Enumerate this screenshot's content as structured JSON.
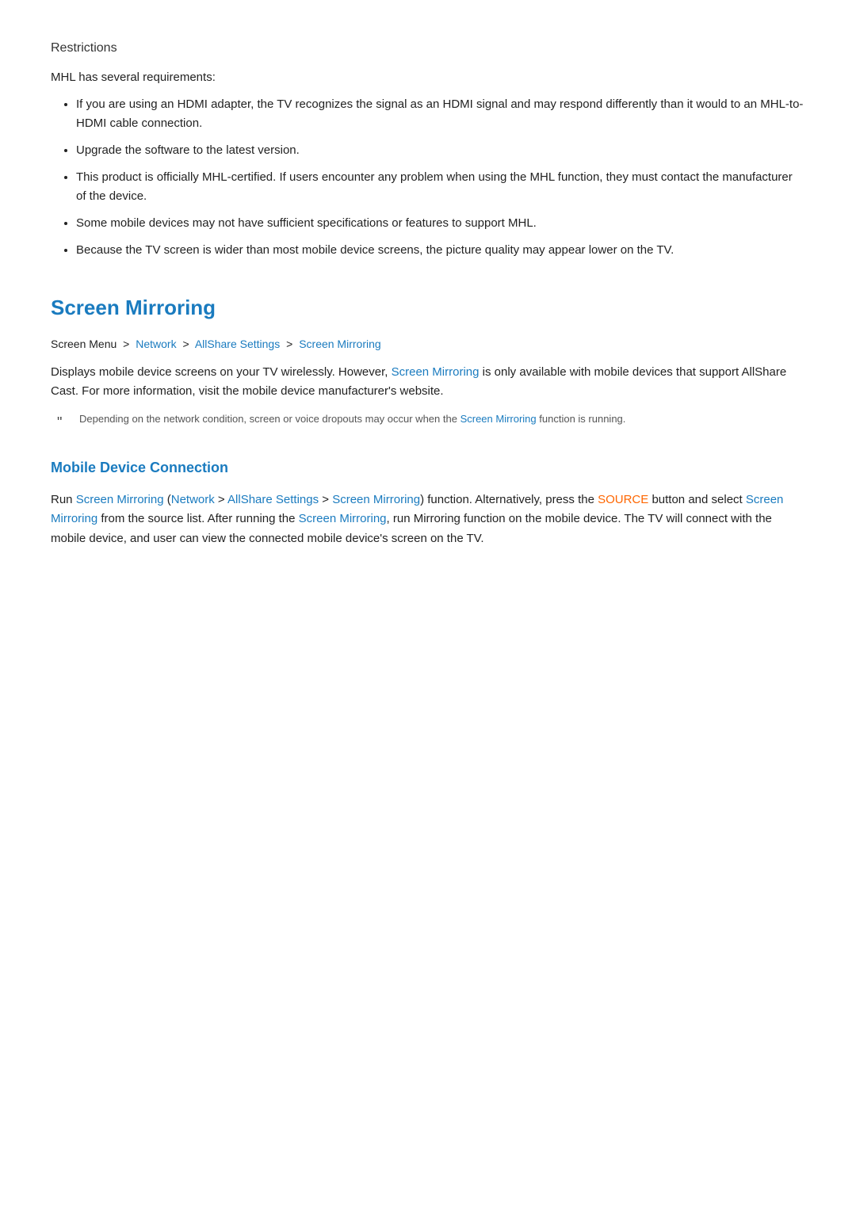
{
  "restrictions": {
    "heading": "Restrictions",
    "intro": "MHL has several requirements:",
    "bullets": [
      "If you are using an HDMI adapter, the TV recognizes the signal as an HDMI signal and may respond differently than it would to an MHL-to-HDMI cable connection.",
      "Upgrade the software to the latest version.",
      "This product is officially MHL-certified. If users encounter any problem when using the MHL function, they must contact the manufacturer of the device.",
      "Some mobile devices may not have sufficient specifications or features to support MHL.",
      "Because the TV screen is wider than most mobile device screens, the picture quality may appear lower on the TV."
    ]
  },
  "screen_mirroring": {
    "title": "Screen Mirroring",
    "breadcrumb": {
      "part1": "Screen Menu",
      "separator1": ">",
      "part2": "Network",
      "separator2": ">",
      "part3": "AllShare Settings",
      "separator3": ">",
      "part4": "Screen Mirroring"
    },
    "body": "Displays mobile device screens on your TV wirelessly. However, Screen Mirroring is only available with mobile devices that support AllShare Cast. For more information, visit the mobile device manufacturer's website.",
    "body_link": "Screen Mirroring",
    "note": "Depending on the network condition, screen or voice dropouts may occur when the Screen Mirroring function is running."
  },
  "mobile_device": {
    "title": "Mobile Device Connection",
    "body1": "Run Screen Mirroring (Network > AllShare Settings > Screen Mirroring) function. Alternatively, press the SOURCE button and select Screen Mirroring from the source list. After running the Screen Mirroring, run Mirroring function on the mobile device. The TV will connect with the mobile device, and user can view the connected mobile device's screen on the TV.",
    "links": {
      "screen_mirroring": "Screen Mirroring",
      "network": "Network",
      "allshare": "AllShare Settings",
      "source": "SOURCE"
    }
  }
}
